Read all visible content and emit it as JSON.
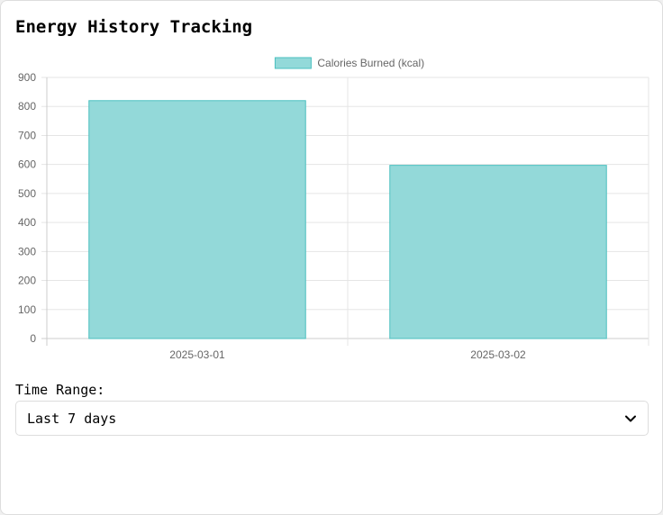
{
  "page": {
    "title": "Energy History Tracking"
  },
  "controls": {
    "range_label": "Time Range:",
    "range_selected": "Last 7 days"
  },
  "colors": {
    "bar_fill": "#93d9d9",
    "bar_stroke": "#4bc0c0",
    "grid": "#e5e5e5",
    "axis": "#cccccc"
  },
  "chart_data": {
    "type": "bar",
    "categories": [
      "2025-03-01",
      "2025-03-02"
    ],
    "series": [
      {
        "name": "Calories Burned (kcal)",
        "values": [
          820,
          597
        ]
      }
    ],
    "yticks": [
      0,
      100,
      200,
      300,
      400,
      500,
      600,
      700,
      800,
      900
    ],
    "ylim": [
      0,
      900
    ],
    "grid": true,
    "legend": "top-center"
  }
}
